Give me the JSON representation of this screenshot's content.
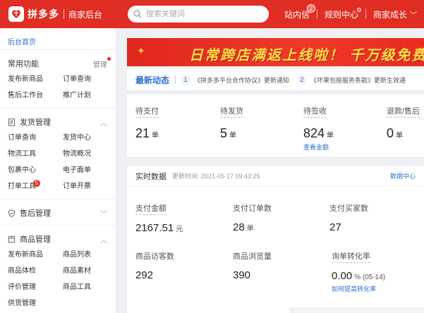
{
  "header": {
    "logo_text": "拼多多",
    "logo_sub": "商家后台",
    "search_placeholder": "搜索关键词",
    "links": [
      {
        "label": "站内信",
        "badge": "2"
      },
      {
        "label": "规则中心"
      },
      {
        "label": "商家成长",
        "chevron": "﹀"
      }
    ]
  },
  "sidebar": {
    "home": "后台首页",
    "common": {
      "title": "常用功能",
      "manage": "管理",
      "items": [
        "发布新商品",
        "订单查询",
        "售后工作台",
        "推广计划"
      ]
    },
    "shipping": {
      "title": "发货管理",
      "caret": "︿",
      "items": [
        "订单查询",
        "发货中心",
        "物流工具",
        "物流概况",
        "包裹中心",
        "电子面单",
        "打单工具",
        "订单开票"
      ],
      "tool_badge": "5"
    },
    "aftersale": {
      "title": "售后管理",
      "caret": "﹀"
    },
    "goods": {
      "title": "商品管理",
      "caret": "︿",
      "items": [
        "发布新商品",
        "商品列表",
        "商品体检",
        "商品素材",
        "评价管理",
        "商品工具",
        "供货管理"
      ]
    }
  },
  "banner": {
    "text": "日常跨店满返上线啦！ 千万级免费"
  },
  "news": {
    "title": "最新动态",
    "items": [
      {
        "num": "1",
        "text": "《拼多多平台合作协议》更新通知"
      },
      {
        "num": "2",
        "text": "《坏果包赔服务条款》更新生效通"
      }
    ]
  },
  "orders": {
    "items": [
      {
        "label": "待支付",
        "value": "21",
        "unit": "单"
      },
      {
        "label": "待发货",
        "value": "5",
        "unit": "单"
      },
      {
        "label": "待签收",
        "value": "824",
        "unit": "单"
      },
      {
        "label": "退款/售后",
        "value": "0",
        "unit": "单"
      }
    ],
    "link": "查看金额"
  },
  "realtime": {
    "title": "实时数据",
    "time_label": "更新时间: 2021-05-17 09:43:25",
    "center_link": "数据中心",
    "metrics": [
      {
        "label": "支付金额",
        "value": "2167.51",
        "unit": "元"
      },
      {
        "label": "支付订单数",
        "value": "28",
        "unit": "单"
      },
      {
        "label": "支付买家数",
        "value": "27",
        "unit": ""
      },
      {
        "label": "商品访客数",
        "value": "292",
        "unit": ""
      },
      {
        "label": "商品浏览量",
        "value": "390",
        "unit": ""
      },
      {
        "label": "询单转化率",
        "value": "0.00",
        "unit": "% (05-14)"
      }
    ],
    "improve_link": "如何提高转化率"
  },
  "colors": {
    "brand": "#e02e24",
    "link": "#2d6fd3",
    "banner_text": "#ffe24a"
  }
}
